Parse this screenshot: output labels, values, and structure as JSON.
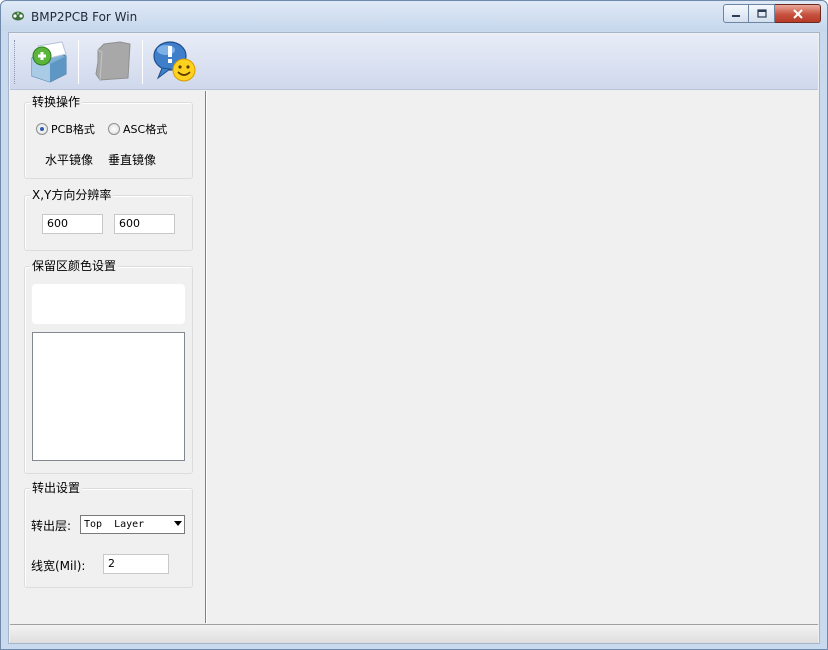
{
  "window": {
    "title": "BMP2PCB For Win",
    "accent": "#c9d9ee"
  },
  "toolbar": {
    "buttons": [
      {
        "icon": "convert-icon"
      },
      {
        "icon": "image-placeholder-icon"
      },
      {
        "icon": "help-smiley-icon"
      }
    ]
  },
  "convert_group": {
    "title": "转换操作",
    "radio_pcb": "PCB格式",
    "radio_asc": "ASC格式",
    "selected": "PCB格式",
    "mirror_h": "水平镜像",
    "mirror_v": "垂直镜像"
  },
  "resolution_group": {
    "title": "X,Y方向分辨率",
    "x_value": "600",
    "y_value": "600"
  },
  "color_group": {
    "title": "保留区颜色设置"
  },
  "output_group": {
    "title": "转出设置",
    "layer_label": "转出层:",
    "layer_value": "Top  Layer",
    "width_label": "线宽(Mil):",
    "width_value": "2"
  }
}
